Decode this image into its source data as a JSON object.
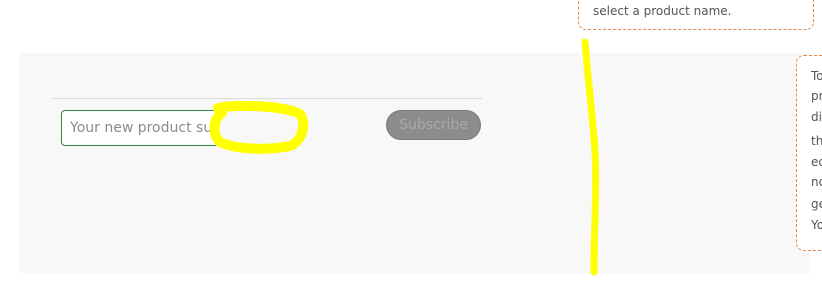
{
  "subscribe_form": {
    "input_placeholder": "Your new product sub",
    "button_label": "Subscribe"
  },
  "tooltip_top": {
    "text": "select a product name."
  },
  "tooltip_right": {
    "lines": [
      "To",
      "pr",
      "di",
      "th",
      "ed",
      "no",
      "ge",
      "Yo"
    ]
  },
  "colors": {
    "input_border": "#2e8b3e",
    "tooltip_border": "#e08850",
    "highlight": "#ffff00",
    "panel_bg": "#f8f8f8",
    "button_bg": "#8c8c8c"
  }
}
